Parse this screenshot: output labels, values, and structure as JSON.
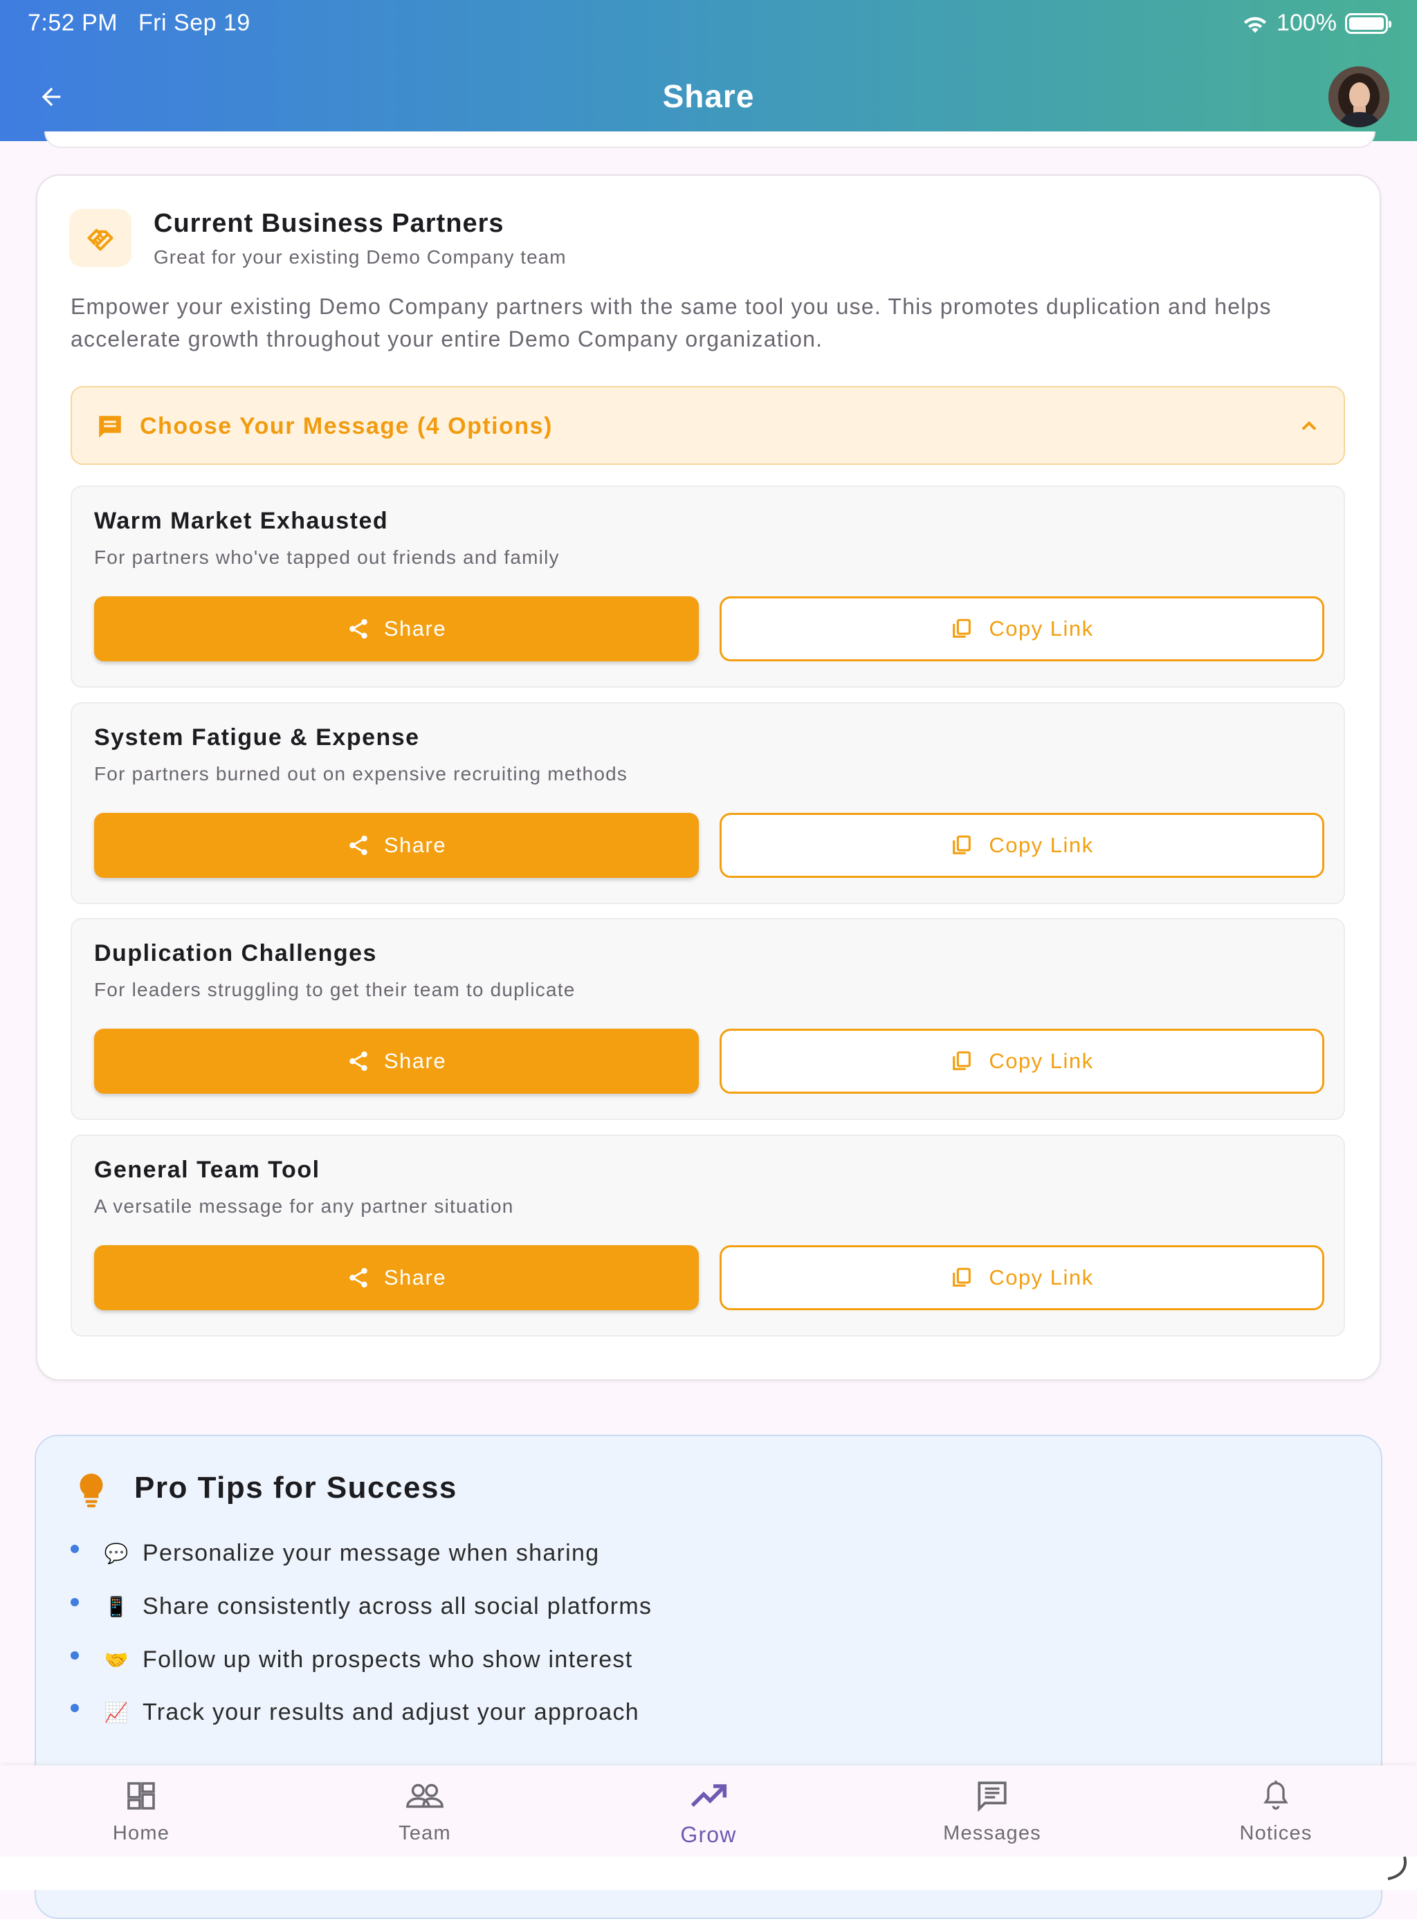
{
  "status_bar": {
    "time": "7:52 PM",
    "date": "Fri Sep 19",
    "battery": "100%"
  },
  "header": {
    "title": "Share"
  },
  "partners_card": {
    "title": "Current Business Partners",
    "subtitle": "Great for your existing Demo Company team",
    "description": "Empower your existing Demo Company partners with the same tool you use. This promotes duplication and helps accelerate growth throughout your entire Demo Company organization.",
    "message_header": "Choose Your Message (4 Options)",
    "options": [
      {
        "title": "Warm Market Exhausted",
        "subtitle": "For partners who've tapped out friends and family",
        "share_label": "Share",
        "copy_label": "Copy Link"
      },
      {
        "title": "System Fatigue & Expense",
        "subtitle": "For partners burned out on expensive recruiting methods",
        "share_label": "Share",
        "copy_label": "Copy Link"
      },
      {
        "title": "Duplication Challenges",
        "subtitle": "For leaders struggling to get their team to duplicate",
        "share_label": "Share",
        "copy_label": "Copy Link"
      },
      {
        "title": "General Team Tool",
        "subtitle": "A versatile message for any partner situation",
        "share_label": "Share",
        "copy_label": "Copy Link"
      }
    ]
  },
  "tips": {
    "title": "Pro Tips for Success",
    "items": [
      {
        "emoji": "💬",
        "text": "Personalize your message when sharing"
      },
      {
        "emoji": "📱",
        "text": "Share consistently across all social platforms"
      },
      {
        "emoji": "🤝",
        "text": "Follow up with prospects who show interest"
      },
      {
        "emoji": "📈",
        "text": "Track your results and adjust your approach"
      }
    ]
  },
  "bottom_nav": [
    {
      "label": "Home",
      "icon": "dashboard-icon"
    },
    {
      "label": "Team",
      "icon": "group-icon"
    },
    {
      "label": "Grow",
      "icon": "trending-up-icon",
      "active": true
    },
    {
      "label": "Messages",
      "icon": "messages-icon"
    },
    {
      "label": "Notices",
      "icon": "bell-icon"
    }
  ],
  "colors": {
    "accent": "#f39f10",
    "header_start": "#3f7de0",
    "header_end": "#4ab096",
    "tips_bg": "#edf4fd",
    "nav_active": "#6e5ab0"
  }
}
